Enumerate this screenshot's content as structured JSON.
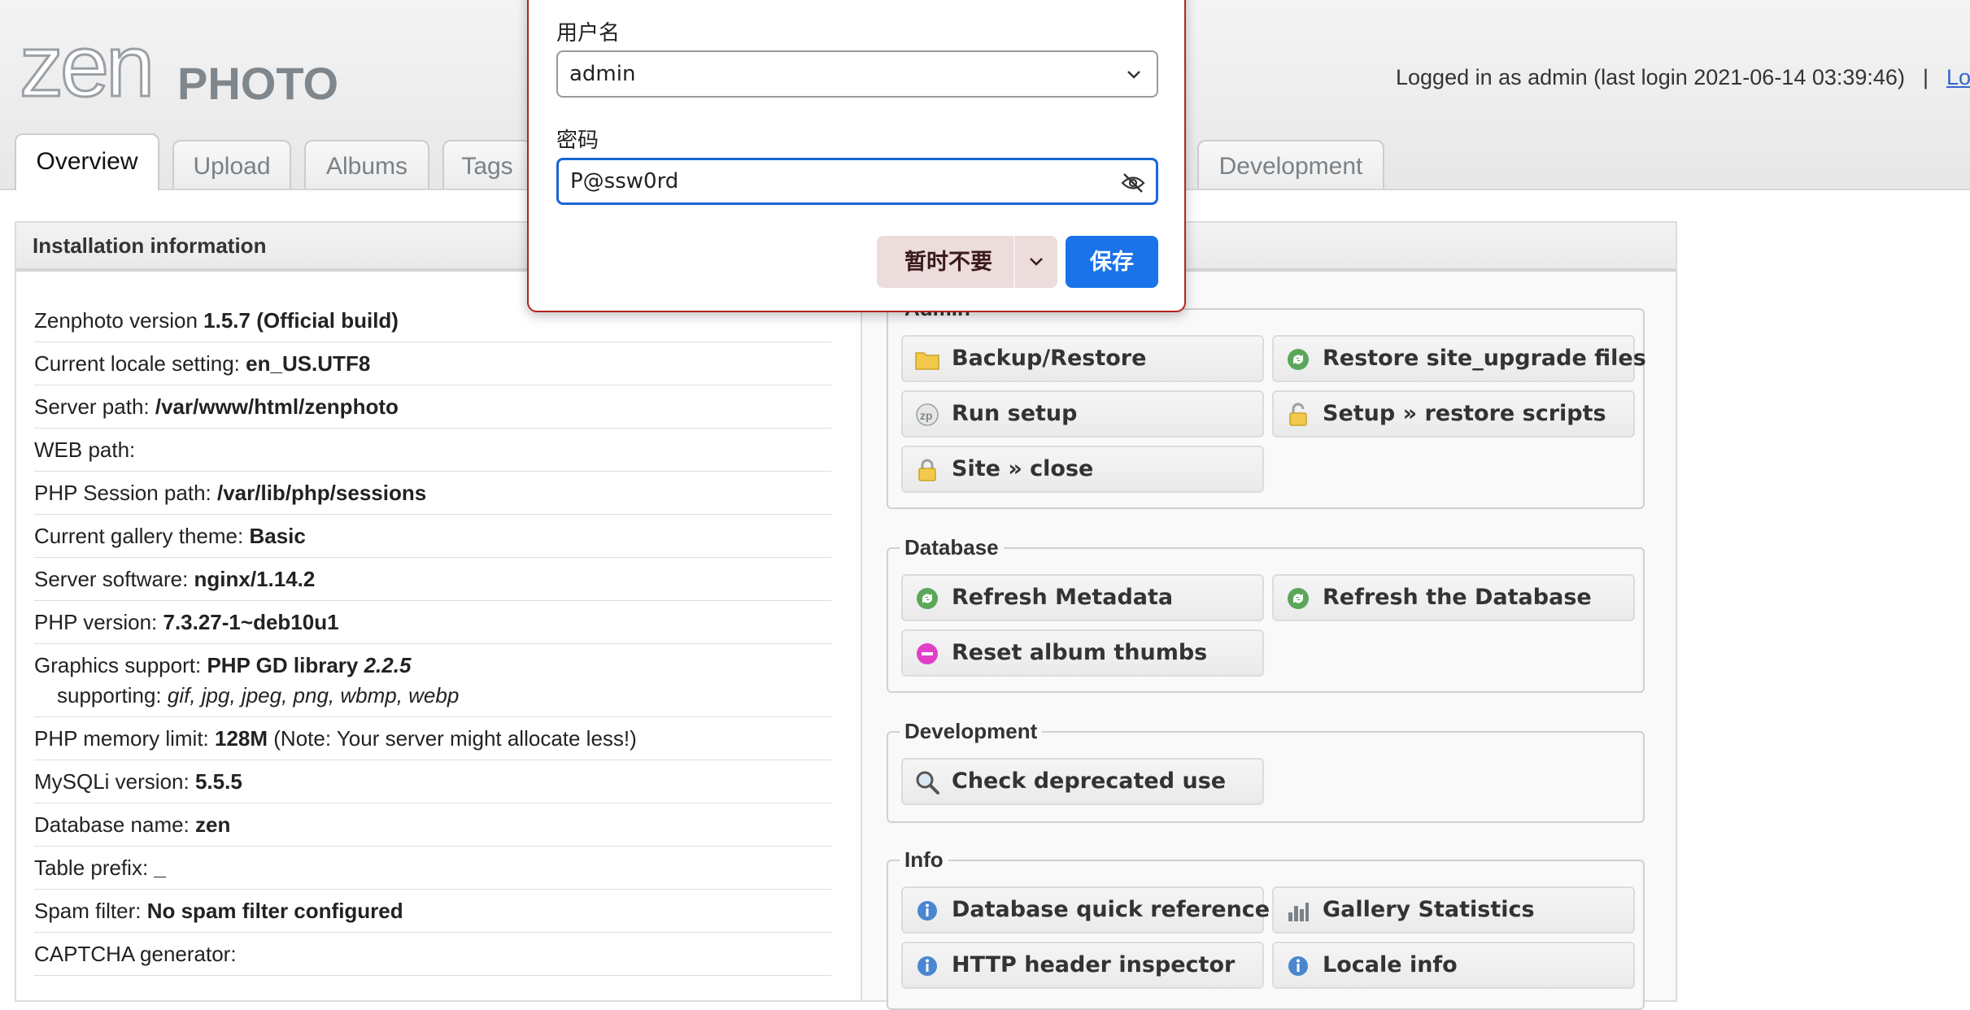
{
  "header": {
    "logo": {
      "zen": "zen",
      "photo": "PHOTO"
    },
    "login_text": "Logged in as admin (last login 2021-06-14 03:39:46)",
    "separator": "|",
    "logout_link": "Log"
  },
  "tabs": [
    {
      "label": "Overview",
      "active": true
    },
    {
      "label": "Upload"
    },
    {
      "label": "Albums"
    },
    {
      "label": "Tags"
    },
    {
      "label": "Development"
    }
  ],
  "install_panel": {
    "title": "Installation information",
    "rows": [
      {
        "label": "Zenphoto version ",
        "value": "1.5.7 (Official build)"
      },
      {
        "label": "Current locale setting: ",
        "value": "en_US.UTF8"
      },
      {
        "label": "Server path: ",
        "value": "/var/www/html/zenphoto"
      },
      {
        "label": "WEB path:",
        "value": ""
      },
      {
        "label": "PHP Session path: ",
        "value": "/var/lib/php/sessions"
      },
      {
        "label": "Current gallery theme: ",
        "value": "Basic"
      },
      {
        "label": "Server software: ",
        "value": "nginx/1.14.2"
      },
      {
        "label": "PHP version: ",
        "value": "7.3.27-1~deb10u1"
      },
      {
        "label": "Graphics support: ",
        "value": "PHP GD library ",
        "value_italic": "2.2.5",
        "sub_label": "supporting: ",
        "sub_value": "gif, jpg, jpeg, png, wbmp, webp"
      },
      {
        "label": "PHP memory limit: ",
        "value": "128M",
        "note": " (Note: Your server might allocate less!)"
      },
      {
        "label": "MySQLi version: ",
        "value": "5.5.5"
      },
      {
        "label": "Database name: ",
        "value": "zen"
      },
      {
        "label": "Table prefix: ",
        "value": "_"
      },
      {
        "label": "Spam filter: ",
        "value": "No spam filter configured"
      },
      {
        "label": "CAPTCHA generator:",
        "value": ""
      }
    ]
  },
  "utilities": {
    "admin": {
      "legend": "Admin",
      "buttons": [
        "Backup/Restore",
        "Restore site_upgrade files",
        "Run setup",
        "Setup » restore scripts",
        "Site » close"
      ]
    },
    "database": {
      "legend": "Database",
      "buttons": [
        "Refresh Metadata",
        "Refresh the Database",
        "Reset album thumbs"
      ]
    },
    "development": {
      "legend": "Development",
      "buttons": [
        "Check deprecated use"
      ]
    },
    "info": {
      "legend": "Info",
      "buttons": [
        "Database quick reference",
        "Gallery Statistics",
        "HTTP header inspector",
        "Locale info"
      ]
    }
  },
  "popup": {
    "username_label": "用户名",
    "username_value": "admin",
    "password_label": "密码",
    "password_value": "P@ssw0rd",
    "not_now_label": "暂时不要",
    "save_label": "保存",
    "accent_color": "#1a73e8",
    "border_color": "#b3261e"
  }
}
